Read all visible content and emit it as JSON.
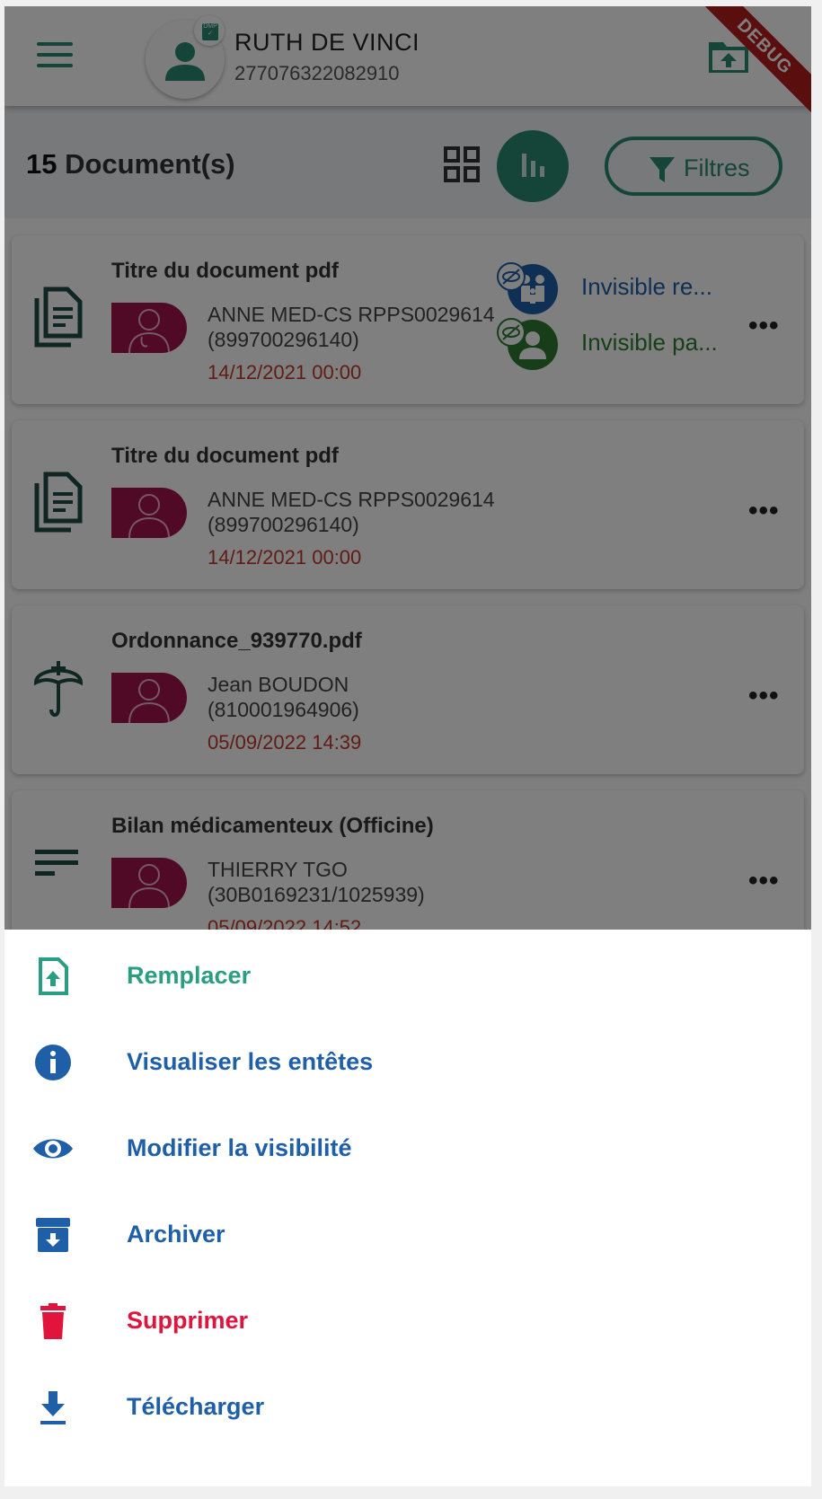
{
  "header": {
    "patient_name": "RUTH DE VINCI",
    "patient_id": "277076322082910",
    "dmp_badge": "DMP",
    "debug_label": "DEBUG"
  },
  "toolbar": {
    "count": "15",
    "count_label": " Document(s)",
    "filter_label": "Filtres"
  },
  "documents": [
    {
      "title": "Titre du document pdf",
      "author": "ANNE MED-CS RPPS0029614",
      "author_id": "(899700296140)",
      "date": "14/12/2021 00:00",
      "type_icon": "document-copy-icon",
      "visibility": [
        {
          "label": "Invisible re...",
          "icon": "family-icon",
          "color": "#1f5fa8"
        },
        {
          "label": "Invisible pa...",
          "icon": "person-icon",
          "color": "#2e7d32"
        }
      ]
    },
    {
      "title": "Titre du document pdf",
      "author": "ANNE MED-CS RPPS0029614",
      "author_id": "(899700296140)",
      "date": "14/12/2021 00:00",
      "type_icon": "document-copy-icon"
    },
    {
      "title": "Ordonnance_939770.pdf",
      "author": "Jean BOUDON",
      "author_id": "(810001964906)",
      "date": "05/09/2022 14:39",
      "type_icon": "umbrella-icon"
    },
    {
      "title": "Bilan médicamenteux (Officine)",
      "author": "THIERRY TGO",
      "author_id": "(30B0169231/1025939)",
      "date": "05/09/2022 14:52",
      "type_icon": "notes-icon"
    }
  ],
  "actions": [
    {
      "label": "Remplacer",
      "icon": "file-upload-icon",
      "color": "#2a9d82"
    },
    {
      "label": "Visualiser les entêtes",
      "icon": "info-icon",
      "color": "#1f5fa8"
    },
    {
      "label": "Modifier la visibilité",
      "icon": "eye-icon",
      "color": "#1f5fa8"
    },
    {
      "label": "Archiver",
      "icon": "archive-icon",
      "color": "#1f5fa8"
    },
    {
      "label": "Supprimer",
      "icon": "trash-icon",
      "color": "#e0143c"
    },
    {
      "label": "Télécharger",
      "icon": "download-icon",
      "color": "#1f5fa8"
    }
  ],
  "colors": {
    "primary": "#2a8a73",
    "blue": "#1f5fa8",
    "danger": "#e0143c",
    "date_red": "#c0392b",
    "author_bg": "#a3154a"
  }
}
